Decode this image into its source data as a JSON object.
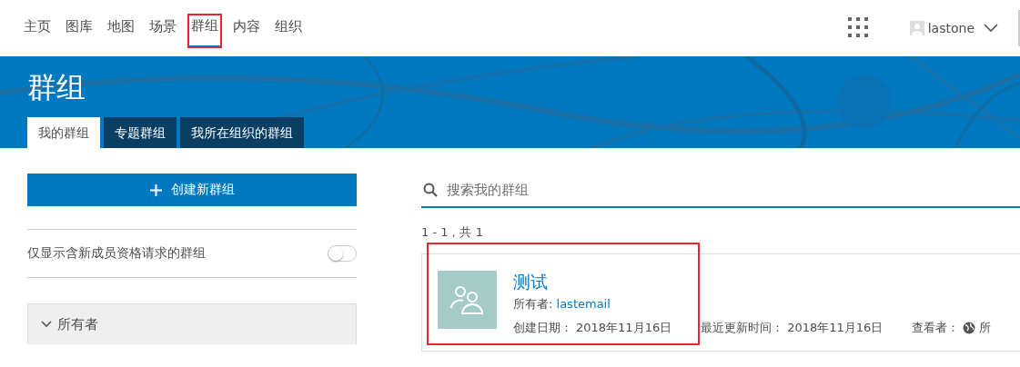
{
  "nav": {
    "items": [
      {
        "label": "主页",
        "selected": false,
        "highlighted": false
      },
      {
        "label": "图库",
        "selected": false,
        "highlighted": false
      },
      {
        "label": "地图",
        "selected": false,
        "highlighted": false
      },
      {
        "label": "场景",
        "selected": false,
        "highlighted": false
      },
      {
        "label": "群组",
        "selected": true,
        "highlighted": true
      },
      {
        "label": "内容",
        "selected": false,
        "highlighted": false
      },
      {
        "label": "组织",
        "selected": false,
        "highlighted": false
      }
    ],
    "user": "lastone"
  },
  "banner": {
    "title": "群组",
    "tabs": [
      {
        "label": "我的群组",
        "selected": true
      },
      {
        "label": "专题群组",
        "selected": false
      },
      {
        "label": "我所在组织的群组",
        "selected": false
      }
    ]
  },
  "sidebar": {
    "create_button": "创建新群组",
    "filter": {
      "label": "仅显示含新成员资格请求的群组",
      "on": false
    },
    "section": {
      "title": "所有者",
      "expanded": true
    }
  },
  "search": {
    "placeholder": "搜索我的群组"
  },
  "result_count": "1 - 1，共 1",
  "groups": [
    {
      "title": "测试",
      "highlighted": true,
      "owner_label": "所有者:",
      "owner": "lastemail",
      "created_label": "创建日期：",
      "created": "2018年11月16日",
      "updated_label": "最近更新时间：",
      "updated": "2018年11月16日",
      "viewer_label": "查看者：",
      "viewer": "所"
    }
  ]
}
